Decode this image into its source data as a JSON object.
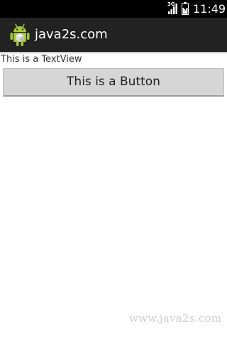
{
  "status_bar": {
    "network": "3G",
    "time": "11:49",
    "icons": [
      "signal-icon",
      "battery-icon"
    ]
  },
  "action_bar": {
    "app_icon": "android-robot-icon",
    "title": "java2s.com"
  },
  "content": {
    "text_view": "This is a TextView",
    "button_label": "This is a Button"
  },
  "watermark": "www.java2s.com",
  "colors": {
    "status_bar_bg": "#000000",
    "action_bar_bg": "#222222",
    "button_bg": "#d6d6d6",
    "android_green": "#a4c639"
  }
}
